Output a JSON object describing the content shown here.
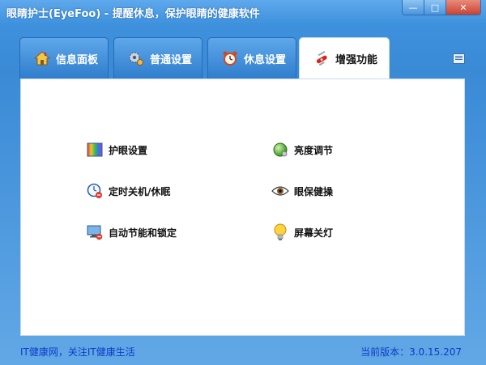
{
  "window": {
    "title": "眼睛护士(EyeFoo) - 提醒休息，保护眼睛的健康软件",
    "controls": {
      "minimize": "—",
      "maximize": "□",
      "close": "✕"
    }
  },
  "tabs": [
    {
      "label": "信息面板",
      "icon": "home-icon",
      "active": false
    },
    {
      "label": "普通设置",
      "icon": "gear-icon",
      "active": false
    },
    {
      "label": "休息设置",
      "icon": "alarm-clock-icon",
      "active": false
    },
    {
      "label": "增强功能",
      "icon": "swiss-knife-icon",
      "active": true
    }
  ],
  "features": {
    "eye_settings": "护眼设置",
    "brightness": "亮度调节",
    "timed_shutdown": "定时关机/休眠",
    "eye_exercise": "眼保健操",
    "power_lock": "自动节能和锁定",
    "screen_off": "屏幕关灯"
  },
  "status": {
    "left": "IT健康网，关注IT健康生活",
    "version": "当前版本：3.0.15.207"
  },
  "colors": {
    "chrome_blue": "#3e91dc",
    "link_blue": "#0b3cc6",
    "content_bg": "#ffffff"
  }
}
